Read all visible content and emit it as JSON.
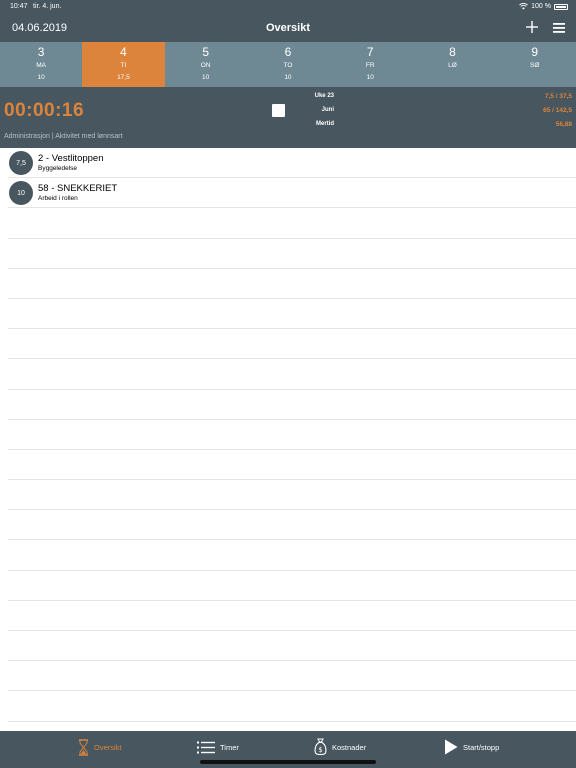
{
  "status_bar": {
    "time": "10:47",
    "date": "tir. 4. jun.",
    "battery": "100 %"
  },
  "nav": {
    "date": "04.06.2019",
    "title": "Oversikt",
    "icons": [
      "plus-icon",
      "hamburger-menu-icon"
    ]
  },
  "week": {
    "days": [
      {
        "num": "3",
        "abbr": "MA",
        "hours": "10"
      },
      {
        "num": "4",
        "abbr": "TI",
        "hours": "17,5"
      },
      {
        "num": "5",
        "abbr": "ON",
        "hours": "10"
      },
      {
        "num": "6",
        "abbr": "TO",
        "hours": "10"
      },
      {
        "num": "7",
        "abbr": "FR",
        "hours": "10"
      },
      {
        "num": "8",
        "abbr": "LØ",
        "hours": ""
      },
      {
        "num": "9",
        "abbr": "SØ",
        "hours": ""
      }
    ],
    "active_index": 1
  },
  "timer": {
    "elapsed": "00:00:16",
    "activity": "Administrasjon | Aktivitet med lønnsart",
    "stats": [
      {
        "label": "Uke 23",
        "value": "7,5 / 37,5"
      },
      {
        "label": "Juni",
        "value": "65 / 142,5"
      },
      {
        "label": "Mertid",
        "value": "56,88"
      }
    ]
  },
  "entries": [
    {
      "hours": "7,5",
      "title": "2 - Vestlitoppen",
      "subtitle": "Byggeledelse"
    },
    {
      "hours": "10",
      "title": "58 - SNEKKERIET",
      "subtitle": "Arbeid i rollen"
    }
  ],
  "tabs": [
    {
      "label": "Oversikt",
      "icon": "hourglass-icon",
      "active": true
    },
    {
      "label": "Timer",
      "icon": "list-icon",
      "active": false
    },
    {
      "label": "Kostnader",
      "icon": "money-bag-icon",
      "active": false
    },
    {
      "label": "Start/stopp",
      "icon": "play-icon",
      "active": false
    }
  ],
  "colors": {
    "dark": "#48575f",
    "strip": "#6f8994",
    "accent": "#dc843b"
  }
}
